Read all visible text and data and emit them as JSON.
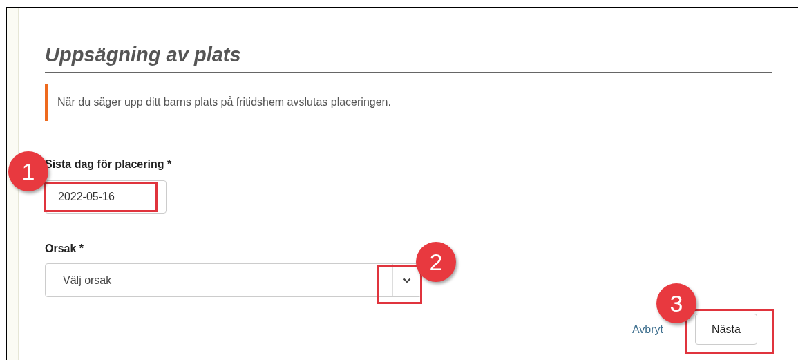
{
  "title": "Uppsägning av plats",
  "notice": "När du säger upp ditt barns plats på fritidshem avslutas placeringen.",
  "fields": [
    {
      "kind": "date",
      "label": "Sista dag för placering *",
      "value": "2022-05-16"
    },
    {
      "kind": "select",
      "label": "Orsak *",
      "placeholder": "Välj orsak"
    }
  ],
  "actions": {
    "cancel": "Avbryt",
    "next": "Nästa"
  },
  "annotations": [
    {
      "number": "1"
    },
    {
      "number": "2"
    },
    {
      "number": "3"
    }
  ]
}
